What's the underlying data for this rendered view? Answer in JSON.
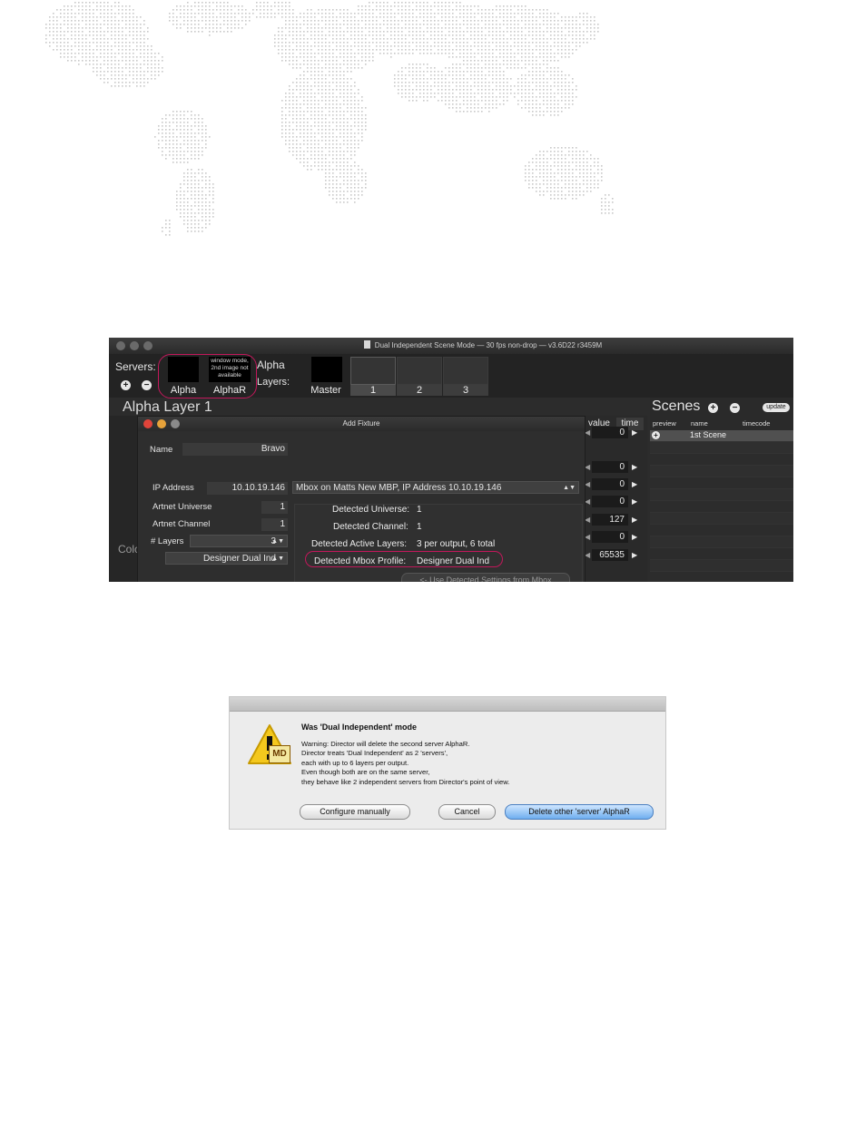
{
  "director_window": {
    "title": "Dual Independent Scene Mode  —  30 fps non-drop  —  v3.6D22 r3459M",
    "servers_label": "Servers:",
    "servers": [
      {
        "name": "Alpha"
      },
      {
        "name": "AlphaR",
        "overlay_text": "window mode, 2nd image not available"
      }
    ],
    "server_name": "Alpha",
    "layers_label": "Layers:",
    "layer_tabs": [
      "Master",
      "1",
      "2",
      "3"
    ],
    "selected_layer_tab": "1",
    "header_title": "Alpha Layer 1",
    "partial_label": "Colc",
    "value_col": "value",
    "time_col": "time",
    "values": [
      "0",
      "0",
      "0",
      "0",
      "127",
      "0",
      "65535"
    ],
    "scenes": {
      "title": "Scenes",
      "update_label": "update",
      "columns": [
        "preview",
        "name",
        "timecode"
      ],
      "rows": [
        {
          "name": "1st Scene"
        }
      ]
    }
  },
  "add_fixture": {
    "title": "Add Fixture",
    "name_label": "Name",
    "name_value": "Bravo",
    "ip_label": "IP Address",
    "ip_value": "10.10.19.146",
    "mbox_select": "Mbox on Matts New MBP, IP Address 10.10.19.146",
    "universe_label": "Artnet Universe",
    "universe_value": "1",
    "channel_label": "Artnet Channel",
    "channel_value": "1",
    "layers_label": "# Layers",
    "layers_value": "3",
    "profile_value": "Designer Dual Ind",
    "detected_universe_label": "Detected Universe:",
    "detected_universe_value": "1",
    "detected_channel_label": "Detected Channel:",
    "detected_channel_value": "1",
    "detected_layers_label": "Detected Active Layers:",
    "detected_layers_value": "3 per output, 6 total",
    "detected_profile_label": "Detected Mbox Profile:",
    "detected_profile_value": "Designer Dual Ind",
    "use_detected_button": "<- Use Detected Settings from Mbox"
  },
  "warning_dialog": {
    "heading": "Was 'Dual Independent' mode",
    "lines": [
      "Warning: Director will delete the second server AlphaR.",
      "Director treats 'Dual Independent' as 2 'servers',",
      "each with up to 6 layers per output.",
      "Even though both are on the same server,",
      "they behave like 2 independent servers from Director's point of view."
    ],
    "icon_text": "MD",
    "buttons": {
      "configure": "Configure manually",
      "cancel": "Cancel",
      "delete": "Delete other 'server' AlphaR"
    }
  },
  "colors": {
    "highlight_ring": "#c2185b",
    "default_button": "#7db6ee",
    "dark_ui": "#2c2c2c",
    "map_dots": "#c9c9c9"
  }
}
